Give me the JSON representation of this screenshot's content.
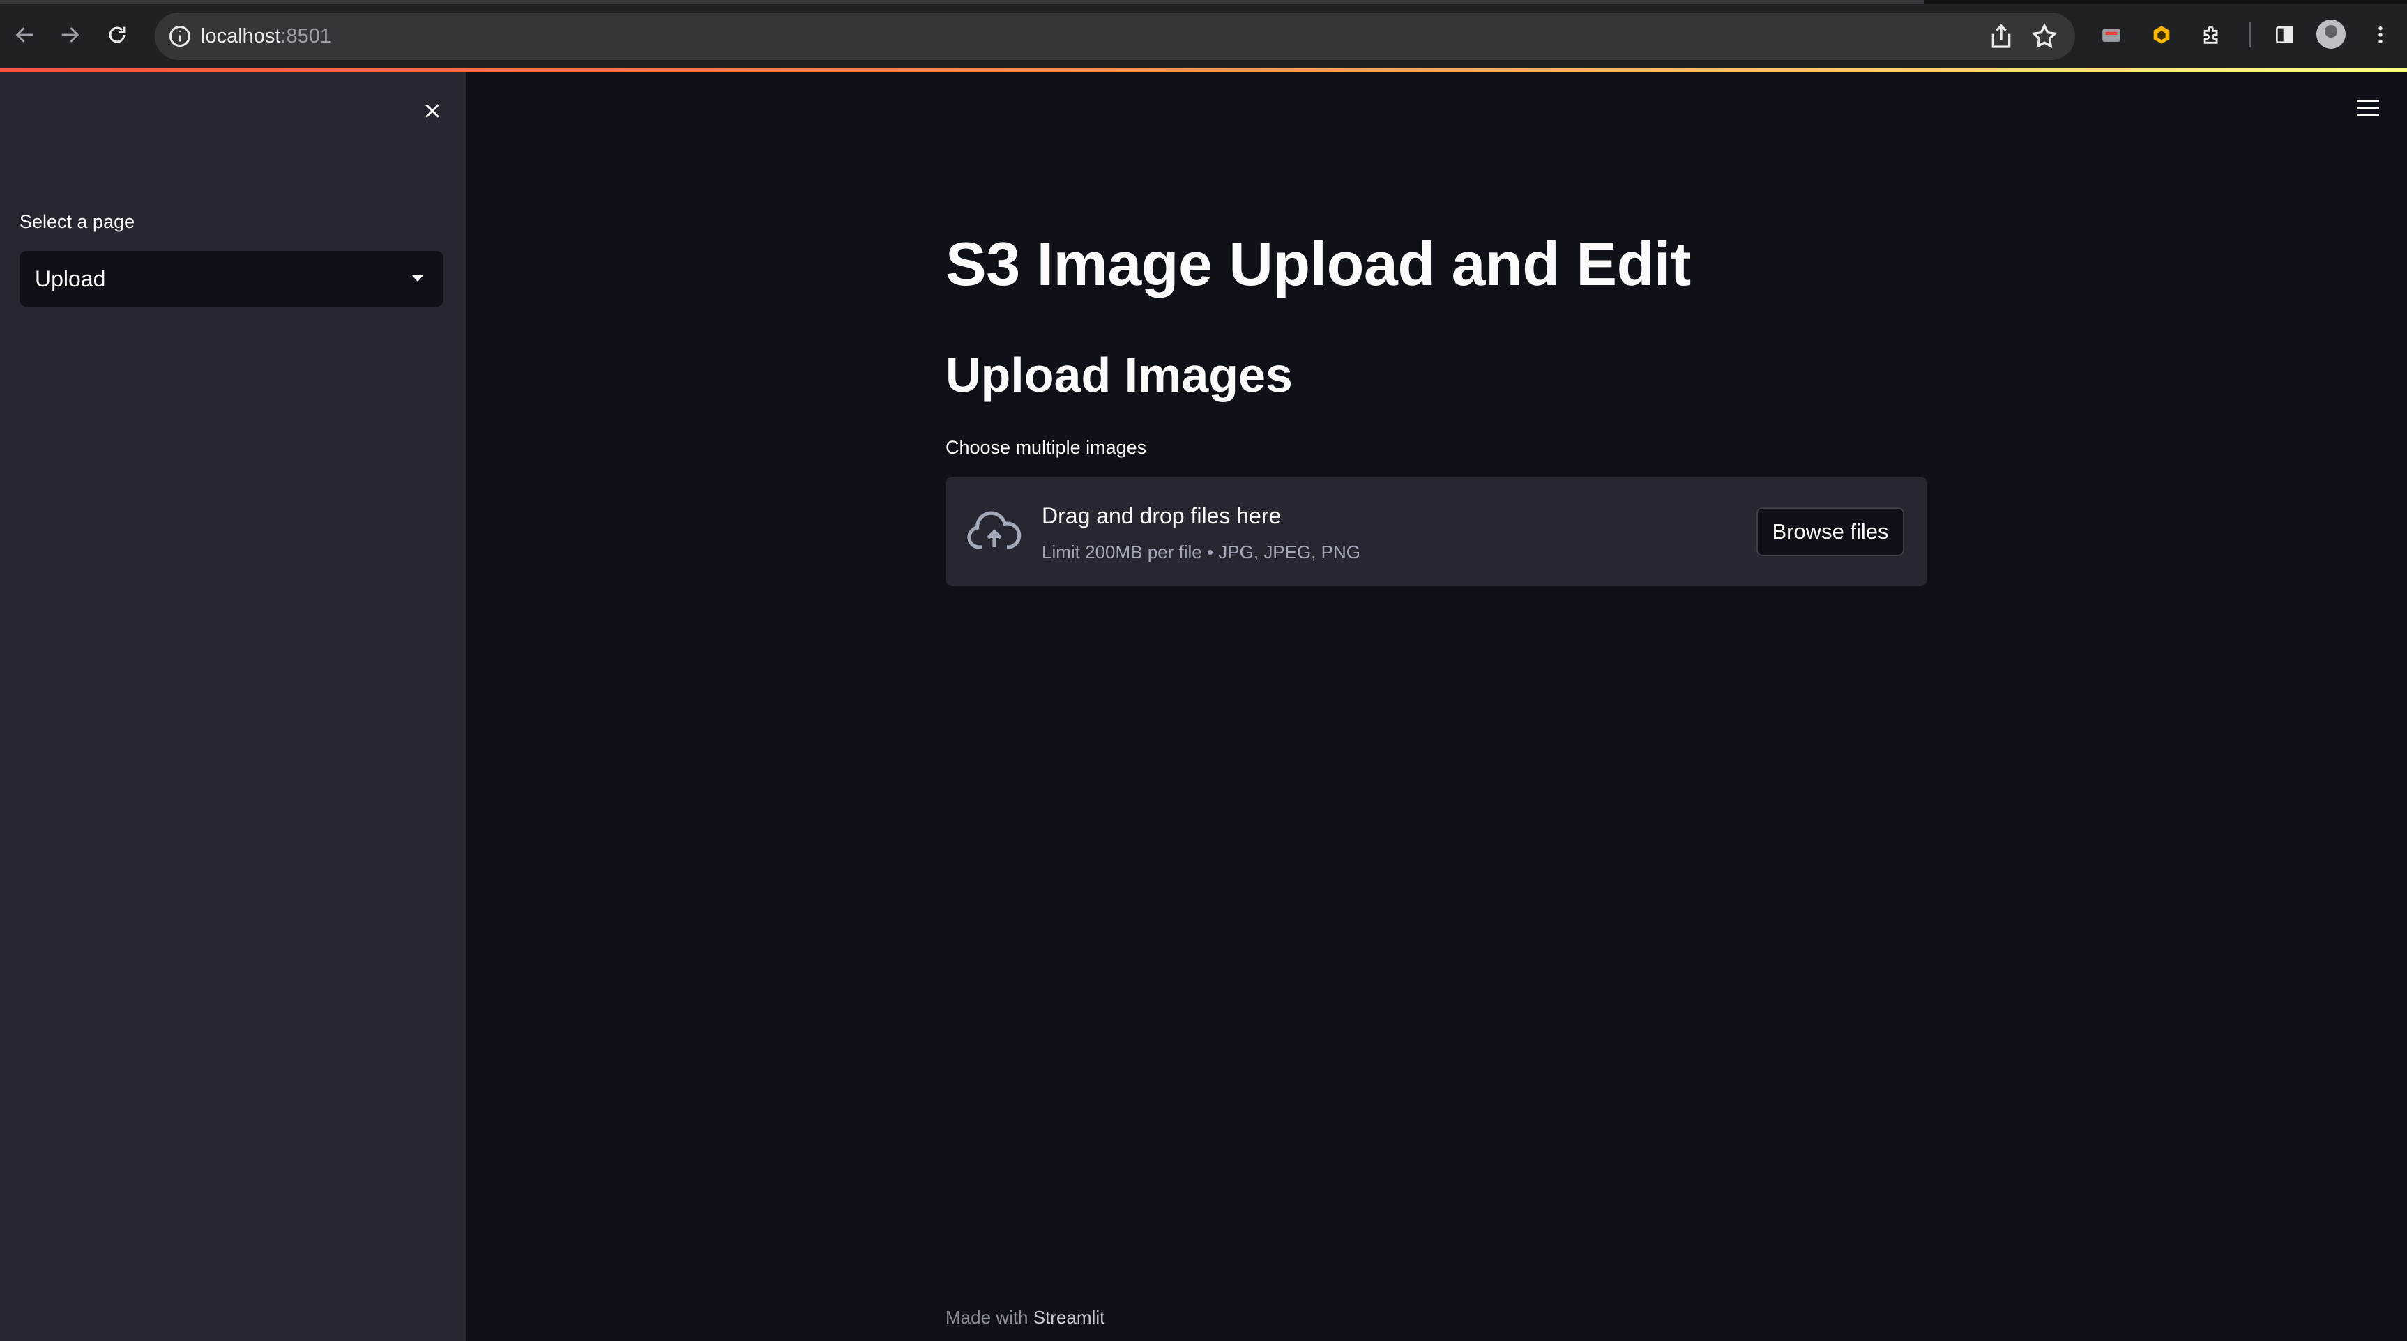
{
  "browser": {
    "url_host": "localhost",
    "url_port": ":8501",
    "icons": [
      "back-icon",
      "forward-icon",
      "reload-icon",
      "site-info-icon",
      "share-icon",
      "bookmark-star-icon",
      "extension-icon",
      "extension-icon",
      "puzzle-icon",
      "side-panel-icon",
      "profile-avatar",
      "kebab-menu-icon"
    ]
  },
  "sidebar": {
    "close_icon": "close-icon",
    "select_label": "Select a page",
    "select_value": "Upload"
  },
  "main": {
    "menu_icon": "hamburger-menu-icon",
    "title": "S3 Image Upload and Edit",
    "section_title": "Upload Images",
    "uploader": {
      "label": "Choose multiple images",
      "drop_title": "Drag and drop files here",
      "drop_limit": "Limit 200MB per file • JPG, JPEG, PNG",
      "browse_label": "Browse files",
      "icon": "cloud-upload-icon"
    },
    "footer": {
      "prefix": "Made with ",
      "brand": "Streamlit"
    }
  },
  "colors": {
    "background": "#0e1117",
    "sidebar": "#262730",
    "text": "#fafafa",
    "accent": "#ff4b4b"
  }
}
